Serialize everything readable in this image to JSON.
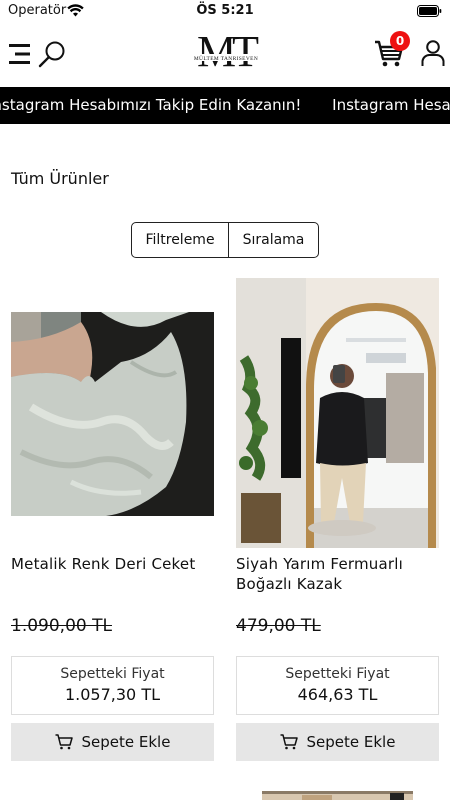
{
  "status_bar": {
    "carrier": "Operatör",
    "time": "ÖS 5:21"
  },
  "header": {
    "logo_letters": "MT",
    "logo_subtitle": "MÜLTEM TANRISEVEN",
    "cart_count": "0"
  },
  "announcement": {
    "items": [
      "Instagram Hesabımızı Takip Edin Kazanın!",
      "Instagram Hesabımızı Takip Edin Kazanın!"
    ]
  },
  "section_title": "Tüm Ürünler",
  "toolbar": {
    "filter_label": "Filtreleme",
    "sort_label": "Sıralama"
  },
  "products": [
    {
      "name": "Metalik Renk Deri Ceket",
      "old_price": "1.090,00 TL",
      "cart_price_label": "Sepetteki Fiyat",
      "cart_price": "1.057,30 TL",
      "add_label": "Sepete Ekle"
    },
    {
      "name": "Siyah Yarım Fermuarlı Boğazlı Kazak",
      "old_price": "479,00 TL",
      "cart_price_label": "Sepetteki Fiyat",
      "cart_price": "464,63 TL",
      "add_label": "Sepete Ekle"
    }
  ],
  "icons": {
    "menu": "menu-icon",
    "search": "search-icon",
    "cart": "cart-icon",
    "user": "user-icon",
    "wifi": "wifi-icon",
    "battery": "battery-icon",
    "add_to_cart": "cart-icon"
  },
  "colors": {
    "banner_bg": "#000000",
    "badge": "#e11111",
    "button_bg": "#e6e6e6"
  }
}
